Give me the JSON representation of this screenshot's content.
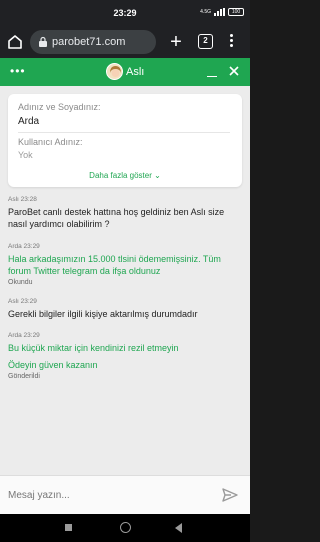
{
  "status_bar": {
    "time": "23:29",
    "network": "4.5G",
    "battery": "100"
  },
  "browser": {
    "url": "parobet71.com",
    "tab_count": "2",
    "icons": [
      "home-icon",
      "lock-icon",
      "plus-icon",
      "tabs-icon",
      "menu-icon"
    ]
  },
  "chat_header": {
    "agent_name": "Aslı",
    "bg_color": "#1fa651"
  },
  "form": {
    "name_label": "Adınız ve Soyadınız:",
    "name_value": "Arda",
    "username_label": "Kullanıcı Adınız:",
    "username_value": "Yok",
    "show_more": "Daha fazla göster ⌄"
  },
  "messages": [
    {
      "meta": "Aslı 23:28",
      "text": "ParoBet canlı destek hattına hoş geldiniz ben Aslı size nasıl yardımcı olabilirim ?",
      "type": "agent"
    },
    {
      "meta": "Arda 23:29",
      "text": "Hala arkadaşımızın 15.000 tlsini ödememişsiniz. Tüm forum Twitter telegram da ifşa oldunuz",
      "status": "Okundu",
      "type": "user"
    },
    {
      "meta": "Aslı 23:29",
      "text": "Gerekli bilgiler ilgili kişiye aktarılmış durumdadır",
      "type": "agent"
    },
    {
      "meta": "Arda 23:29",
      "text": "Bu küçük miktar için kendinizi rezil etmeyin",
      "type": "user"
    },
    {
      "text": "Ödeyin güven kazanın",
      "status": "Gönderildi",
      "type": "user"
    }
  ],
  "input": {
    "placeholder": "Mesaj yazın..."
  },
  "colors": {
    "accent": "#1fa651",
    "chat_bg": "#ececec"
  }
}
